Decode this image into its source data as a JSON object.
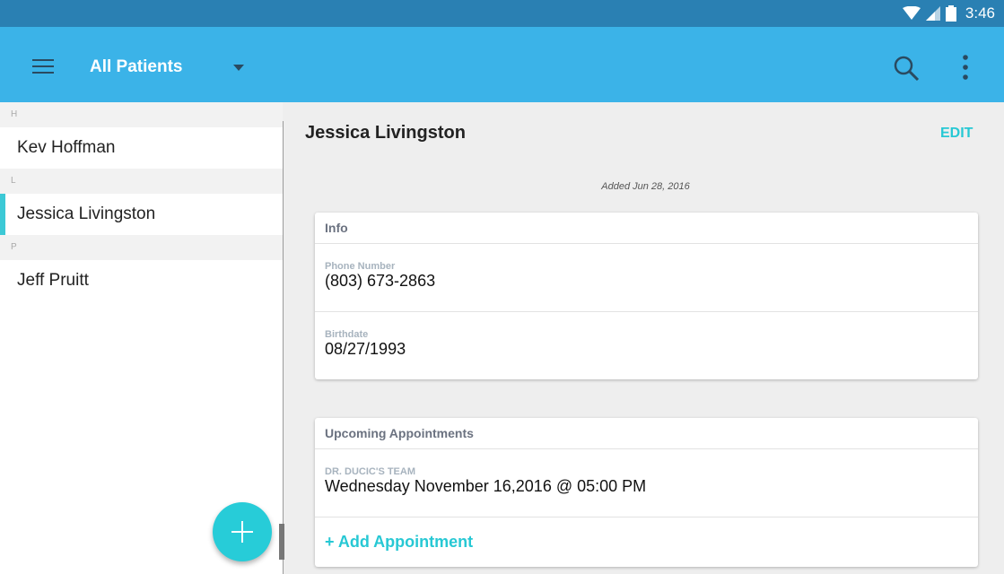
{
  "status_bar": {
    "time": "3:46",
    "icons": [
      "wifi-icon",
      "signal-icon",
      "battery-icon"
    ]
  },
  "app_bar": {
    "title": "All Patients",
    "icons": [
      "menu-icon",
      "dropdown-caret-icon",
      "search-icon",
      "more-vert-icon"
    ]
  },
  "sidebar": {
    "groups": [
      {
        "letter": "H",
        "patients": [
          "Kev Hoffman"
        ]
      },
      {
        "letter": "L",
        "patients": [
          "Jessica Livingston"
        ]
      },
      {
        "letter": "P",
        "patients": [
          "Jeff Pruitt"
        ]
      }
    ],
    "selected": "Jessica Livingston"
  },
  "detail": {
    "name": "Jessica Livingston",
    "edit_label": "EDIT",
    "added": "Added Jun 28, 2016",
    "info_card": {
      "title": "Info",
      "phone_label": "Phone Number",
      "phone": "(803) 673-2863",
      "birth_label": "Birthdate",
      "birthdate": "08/27/1993"
    },
    "appointments_card": {
      "title": "Upcoming Appointments",
      "team_label": "DR. DUCIC'S TEAM",
      "appointment": "Wednesday November 16,2016 @ 05:00 PM",
      "add_label": "+ Add Appointment"
    }
  },
  "colors": {
    "status_bar": "#2a80b3",
    "app_bar": "#3bb3e8",
    "accent": "#27c8d4"
  }
}
